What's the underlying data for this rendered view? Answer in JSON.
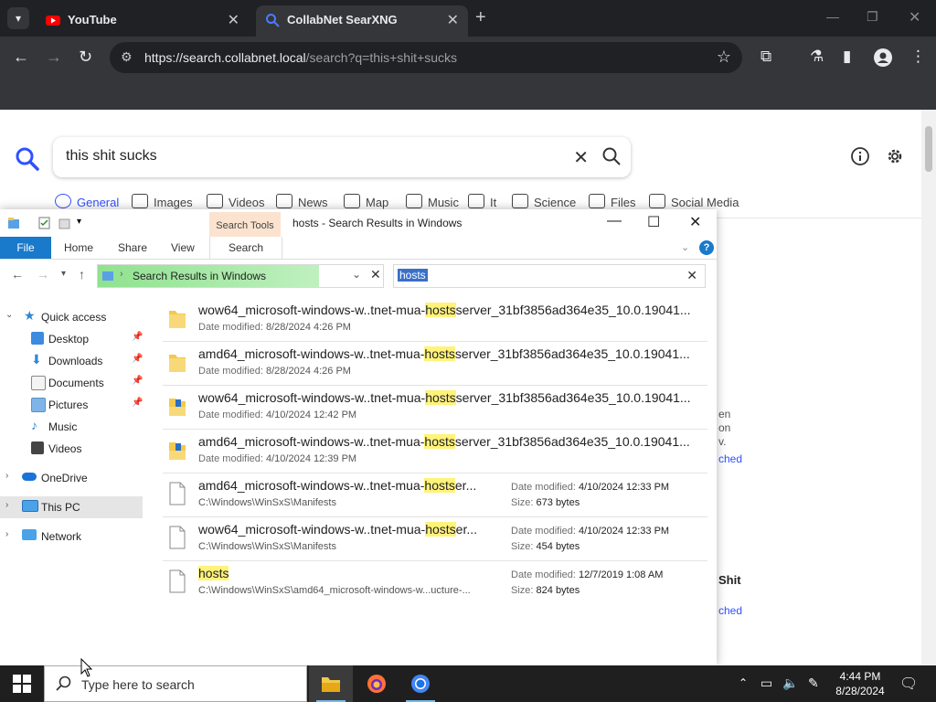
{
  "browser": {
    "tabs": [
      {
        "title": "YouTube",
        "close": "✕"
      },
      {
        "title": "CollabNet SearXNG",
        "close": "✕"
      }
    ],
    "new_tab": "+",
    "url_domain": "https://search.collabnet.local",
    "url_path": "/search?q=this+shit+sucks"
  },
  "search": {
    "query": "this shit sucks",
    "categories": [
      "General",
      "Images",
      "Videos",
      "News",
      "Map",
      "Music",
      "It",
      "Science",
      "Files",
      "Social Media"
    ],
    "peek_text": {
      "line1": "en",
      "line2": "on",
      "line3": "v.",
      "link1": "ched",
      "bold": "Shit",
      "link2": "ched"
    }
  },
  "explorer": {
    "title": "hosts - Search Results in Windows",
    "search_tools": "Search Tools",
    "ribbon": {
      "file": "File",
      "home": "Home",
      "share": "Share",
      "view": "View",
      "search": "Search"
    },
    "address": "Search Results in Windows",
    "search_value": "hosts",
    "nav": {
      "quick_access": "Quick access",
      "desktop": "Desktop",
      "downloads": "Downloads",
      "documents": "Documents",
      "pictures": "Pictures",
      "music": "Music",
      "videos": "Videos",
      "onedrive": "OneDrive",
      "this_pc": "This PC",
      "network": "Network"
    },
    "results": [
      {
        "pre": "wow64_microsoft-windows-w..tnet-mua-",
        "hl": "hosts",
        "post": "server_31bf3856ad364e35_10.0.19041...",
        "sub_label": "Date modified:",
        "sub_value": "8/28/2024 4:26 PM"
      },
      {
        "pre": "amd64_microsoft-windows-w..tnet-mua-",
        "hl": "hosts",
        "post": "server_31bf3856ad364e35_10.0.19041...",
        "sub_label": "Date modified:",
        "sub_value": "8/28/2024 4:26 PM"
      },
      {
        "pre": "wow64_microsoft-windows-w..tnet-mua-",
        "hl": "hosts",
        "post": "server_31bf3856ad364e35_10.0.19041...",
        "sub_label": "Date modified:",
        "sub_value": "4/10/2024 12:42 PM"
      },
      {
        "pre": "amd64_microsoft-windows-w..tnet-mua-",
        "hl": "hosts",
        "post": "server_31bf3856ad364e35_10.0.19041...",
        "sub_label": "Date modified:",
        "sub_value": "4/10/2024 12:39 PM"
      },
      {
        "pre": "amd64_microsoft-windows-w..tnet-mua-",
        "hl": "hosts",
        "post": "er...",
        "path": "C:\\Windows\\WinSxS\\Manifests",
        "date_label": "Date modified:",
        "date": "4/10/2024 12:33 PM",
        "size_label": "Size:",
        "size": "673 bytes"
      },
      {
        "pre": "wow64_microsoft-windows-w..tnet-mua-",
        "hl": "hosts",
        "post": "er...",
        "path": "C:\\Windows\\WinSxS\\Manifests",
        "date_label": "Date modified:",
        "date": "4/10/2024 12:33 PM",
        "size_label": "Size:",
        "size": "454 bytes"
      },
      {
        "pre": "",
        "hl": "hosts",
        "post": "",
        "path": "C:\\Windows\\WinSxS\\amd64_microsoft-windows-w...ucture-...",
        "date_label": "Date modified:",
        "date": "12/7/2019 1:08 AM",
        "size_label": "Size:",
        "size": "824 bytes"
      }
    ]
  },
  "taskbar": {
    "search_placeholder": "Type here to search",
    "time": "4:44 PM",
    "date": "8/28/2024"
  },
  "colors": {
    "accent": "#3050ff",
    "explorer_blue": "#1979ca",
    "highlight": "#fff37a"
  }
}
